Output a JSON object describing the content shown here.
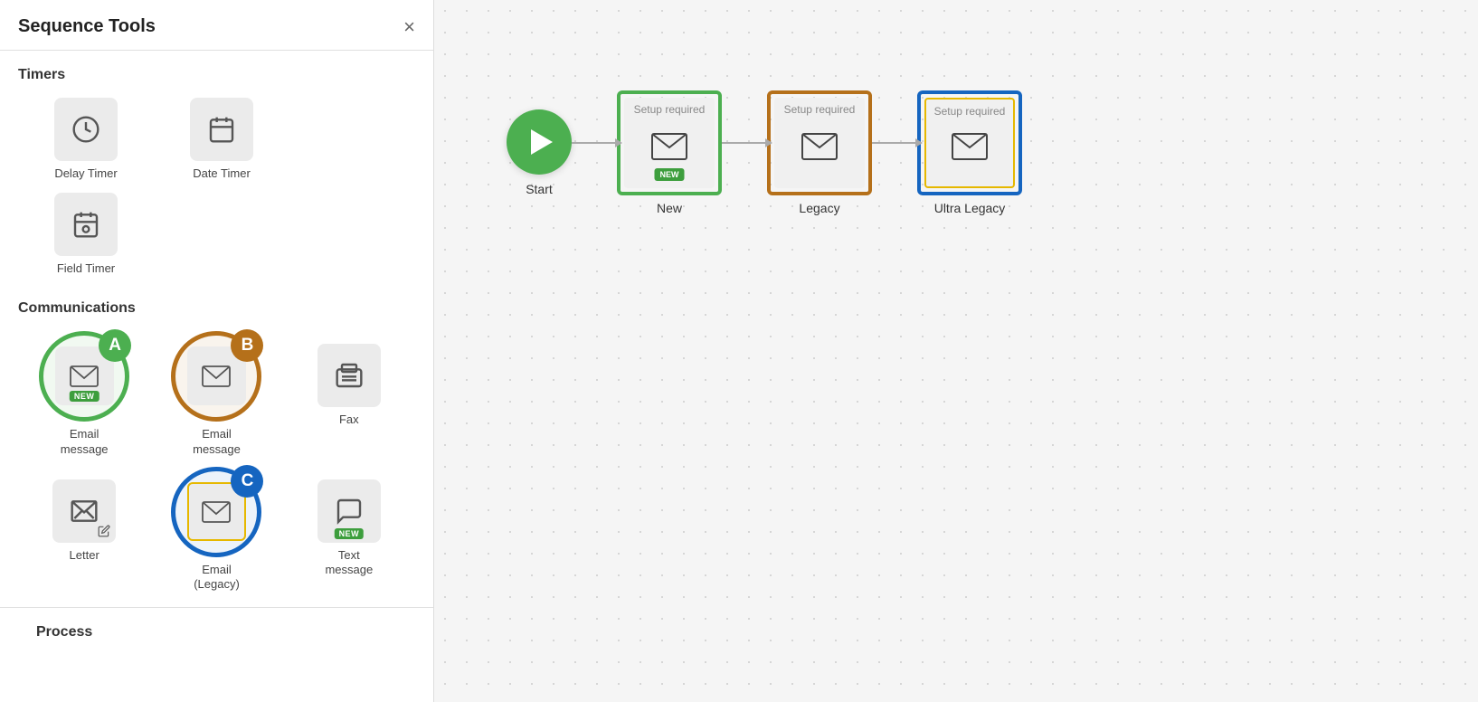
{
  "sidebar": {
    "title": "Sequence Tools",
    "close_label": "×",
    "sections": {
      "timers": {
        "label": "Timers",
        "items": [
          {
            "id": "delay-timer",
            "label": "Delay Timer",
            "icon": "clock"
          },
          {
            "id": "date-timer",
            "label": "Date Timer",
            "icon": "calendar"
          },
          {
            "id": "field-timer",
            "label": "Field Timer",
            "icon": "calendar-person"
          }
        ]
      },
      "communications": {
        "label": "Communications",
        "items": [
          {
            "id": "email-new",
            "label": "Email\nmessage",
            "icon": "mail",
            "badge": "NEW",
            "circle": "green",
            "letter": "A"
          },
          {
            "id": "email-legacy",
            "label": "Email\nmessage",
            "icon": "mail",
            "circle": "brown",
            "letter": "B"
          },
          {
            "id": "fax",
            "label": "Fax",
            "icon": "fax"
          },
          {
            "id": "letter",
            "label": "Letter",
            "icon": "letter"
          },
          {
            "id": "email-ultra-legacy",
            "label": "Email\n(Legacy)",
            "icon": "mail",
            "circle": "blue",
            "letter": "C",
            "inner_border": "gold"
          },
          {
            "id": "text-message",
            "label": "Text\nmessage",
            "icon": "chat",
            "badge": "NEW"
          }
        ]
      },
      "process": {
        "label": "Process"
      }
    }
  },
  "flow": {
    "start": {
      "label": "Start"
    },
    "nodes": [
      {
        "id": "node-new",
        "setup_label": "Setup required",
        "name": "New",
        "badge": "NEW",
        "border_color": "green"
      },
      {
        "id": "node-legacy",
        "setup_label": "Setup required",
        "name": "Legacy",
        "border_color": "brown"
      },
      {
        "id": "node-ultra-legacy",
        "setup_label": "Setup required",
        "name": "Ultra Legacy",
        "border_color": "blue",
        "inner_border": "gold"
      }
    ]
  }
}
